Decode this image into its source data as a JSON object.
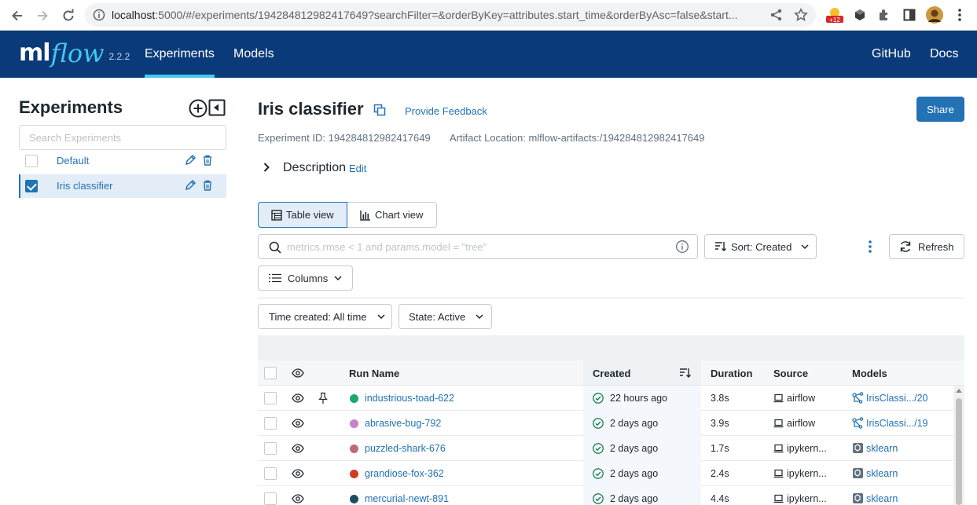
{
  "browser": {
    "url_host": "localhost",
    "url_rest": ":5000/#/experiments/194284812982417649?searchFilter=&orderByKey=attributes.start_time&orderByAsc=false&start...",
    "ext_badge": "+12"
  },
  "header": {
    "logo_ml": "ml",
    "logo_flow": "flow",
    "version": "2.2.2",
    "nav": [
      "Experiments",
      "Models"
    ],
    "right_links": [
      "GitHub",
      "Docs"
    ],
    "bg_color": "#0a3a79",
    "accent": "#43c9ed"
  },
  "sidebar": {
    "title": "Experiments",
    "search_placeholder": "Search Experiments",
    "experiments": [
      {
        "name": "Default",
        "checked": false
      },
      {
        "name": "Iris classifier",
        "checked": true
      }
    ]
  },
  "main": {
    "title": "Iris classifier",
    "feedback": "Provide Feedback",
    "share": "Share",
    "experiment_id": "Experiment ID: 194284812982417649",
    "artifact_location": "Artifact Location: mlflow-artifacts:/194284812982417649",
    "description_label": "Description",
    "description_edit": "Edit",
    "table_view": "Table view",
    "chart_view": "Chart view",
    "search_placeholder": "metrics.rmse < 1 and params.model = \"tree\"",
    "sort_label": "Sort: Created",
    "refresh": "Refresh",
    "columns": "Columns",
    "time_filter": "Time created: All time",
    "state_filter": "State: Active"
  },
  "table": {
    "headers": [
      "Run Name",
      "Created",
      "Duration",
      "Source",
      "Models"
    ],
    "rows": [
      {
        "name": "industrious-toad-622",
        "color": "#1aa86b",
        "created": "22 hours ago",
        "duration": "3.8s",
        "source": "airflow",
        "model": "IrisClassi.../20",
        "model_type": "registered",
        "pinned": true
      },
      {
        "name": "abrasive-bug-792",
        "color": "#c583c9",
        "created": "2 days ago",
        "duration": "3.9s",
        "source": "airflow",
        "model": "IrisClassi.../19",
        "model_type": "registered",
        "pinned": false
      },
      {
        "name": "puzzled-shark-676",
        "color": "#bf6a79",
        "created": "2 days ago",
        "duration": "1.7s",
        "source": "ipykern...",
        "model": "sklearn",
        "model_type": "logged",
        "pinned": false
      },
      {
        "name": "grandiose-fox-362",
        "color": "#d03a26",
        "created": "2 days ago",
        "duration": "2.4s",
        "source": "ipykern...",
        "model": "sklearn",
        "model_type": "logged",
        "pinned": false
      },
      {
        "name": "mercurial-newt-891",
        "color": "#1e4f61",
        "created": "2 days ago",
        "duration": "4.4s",
        "source": "ipykern...",
        "model": "sklearn",
        "model_type": "logged",
        "pinned": false
      }
    ]
  }
}
